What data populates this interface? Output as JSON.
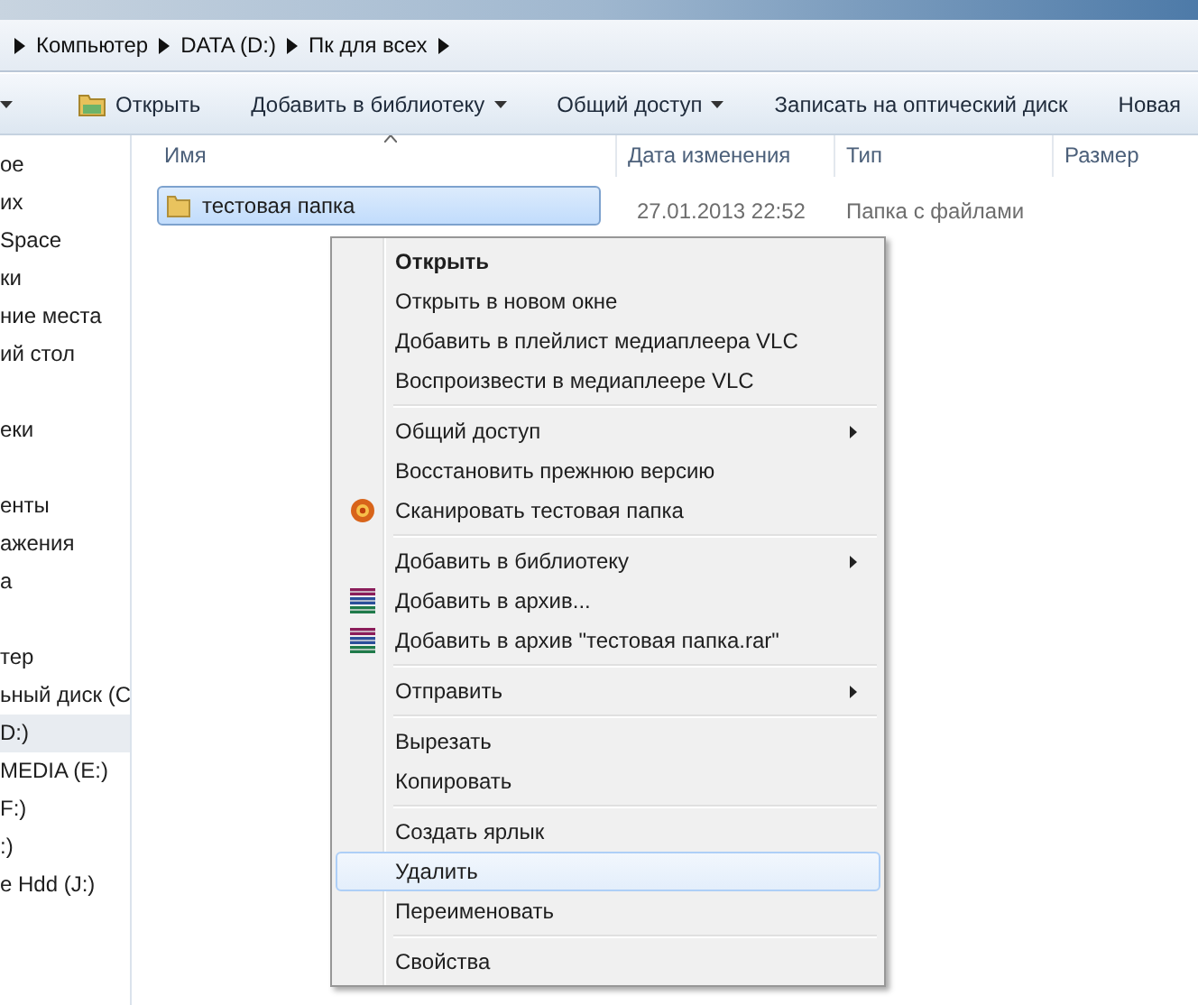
{
  "breadcrumb": [
    "Компьютер",
    "DATA (D:)",
    "Пк для всех"
  ],
  "toolbar": [
    {
      "kind": "cut",
      "dropdown": true
    },
    {
      "label": "Открыть",
      "kind": "open",
      "dropdown": false
    },
    {
      "label": "Добавить в библиотеку",
      "kind": "plain",
      "dropdown": true
    },
    {
      "label": "Общий доступ",
      "kind": "plain",
      "dropdown": true
    },
    {
      "label": "Записать на оптический диск",
      "kind": "plain",
      "dropdown": false
    },
    {
      "label": "Новая",
      "kind": "plain",
      "dropdown": false
    }
  ],
  "sidebar": {
    "groups": [
      [
        {
          "label": "ое",
          "selected": false
        },
        {
          "label": "их",
          "selected": false
        },
        {
          "label": "Space",
          "selected": false
        },
        {
          "label": "ки",
          "selected": false
        },
        {
          "label": "ние места",
          "selected": false
        },
        {
          "label": "ий стол",
          "selected": false
        }
      ],
      [
        {
          "label": "еки",
          "selected": false
        }
      ],
      [
        {
          "label": "енты",
          "selected": false
        },
        {
          "label": "ажения",
          "selected": false
        },
        {
          "label": "а",
          "selected": false
        }
      ],
      [
        {
          "label": "тер",
          "selected": false
        },
        {
          "label": "ьный диск (С",
          "selected": false
        },
        {
          "label": "D:)",
          "selected": true
        },
        {
          "label": "MEDIA (E:)",
          "selected": false
        },
        {
          "label": "F:)",
          "selected": false
        },
        {
          "label": ":)",
          "selected": false
        },
        {
          "label": "e Hdd (J:)",
          "selected": false
        }
      ]
    ]
  },
  "table": {
    "columns": [
      "Имя",
      "Дата изменения",
      "Тип",
      "Размер"
    ],
    "rows": [
      {
        "name": "тестовая папка",
        "date": "27.01.2013 22:52",
        "type": "Папка с файлами",
        "selected": true
      }
    ]
  },
  "context_menu": {
    "groups": [
      [
        {
          "label": "Открыть",
          "kind": "plain",
          "default": true,
          "submenu": false,
          "selected": false
        },
        {
          "label": "Открыть в новом окне",
          "kind": "plain",
          "default": false,
          "submenu": false,
          "selected": false
        },
        {
          "label": "Добавить в плейлист медиаплеера VLC",
          "kind": "plain",
          "default": false,
          "submenu": false,
          "selected": false
        },
        {
          "label": "Воспроизвести в медиаплеере VLC",
          "kind": "plain",
          "default": false,
          "submenu": false,
          "selected": false
        }
      ],
      [
        {
          "label": "Общий доступ",
          "kind": "plain",
          "default": false,
          "submenu": true,
          "selected": false
        },
        {
          "label": "Восстановить прежнюю версию",
          "kind": "plain",
          "default": false,
          "submenu": false,
          "selected": false
        },
        {
          "label": "Сканировать тестовая папка",
          "kind": "antivirus",
          "default": false,
          "submenu": false,
          "selected": false
        }
      ],
      [
        {
          "label": "Добавить в библиотеку",
          "kind": "plain",
          "default": false,
          "submenu": true,
          "selected": false
        },
        {
          "label": "Добавить в архив...",
          "kind": "archive",
          "default": false,
          "submenu": false,
          "selected": false
        },
        {
          "label": "Добавить в архив \"тестовая папка.rar\"",
          "kind": "archive",
          "default": false,
          "submenu": false,
          "selected": false
        }
      ],
      [
        {
          "label": "Отправить",
          "kind": "plain",
          "default": false,
          "submenu": true,
          "selected": false
        }
      ],
      [
        {
          "label": "Вырезать",
          "kind": "plain",
          "default": false,
          "submenu": false,
          "selected": false
        },
        {
          "label": "Копировать",
          "kind": "plain",
          "default": false,
          "submenu": false,
          "selected": false
        }
      ],
      [
        {
          "label": "Создать ярлык",
          "kind": "plain",
          "default": false,
          "submenu": false,
          "selected": false
        },
        {
          "label": "Удалить",
          "kind": "plain",
          "default": false,
          "submenu": false,
          "selected": true
        },
        {
          "label": "Переименовать",
          "kind": "plain",
          "default": false,
          "submenu": false,
          "selected": false
        }
      ],
      [
        {
          "label": "Свойства",
          "kind": "plain",
          "default": false,
          "submenu": false,
          "selected": false
        }
      ]
    ]
  }
}
